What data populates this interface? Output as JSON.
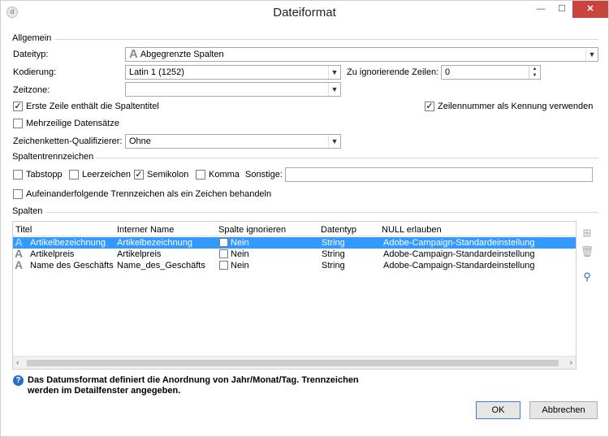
{
  "window": {
    "title": "Dateiformat",
    "min_glyph": "—",
    "max_glyph": "☐",
    "close_glyph": "✕",
    "app_glyph": "d"
  },
  "general": {
    "section_label": "Allgemein",
    "file_type_label": "Dateityp:",
    "file_type_value": "Abgegrenzte Spalten",
    "encoding_label": "Kodierung:",
    "encoding_value": "Latin 1 (1252)",
    "skip_rows_label": "Zu ignorierende Zeilen:",
    "skip_rows_value": "0",
    "timezone_label": "Zeitzone:",
    "timezone_value": "",
    "first_row_titles_label": "Erste Zeile enthält die Spaltentitel",
    "first_row_titles_checked": true,
    "line_number_id_label": "Zeilennummer als Kennung verwenden",
    "line_number_id_checked": true,
    "multiline_label": "Mehrzeilige Datensätze",
    "multiline_checked": false,
    "qualifier_label": "Zeichenketten-Qualifizierer:",
    "qualifier_value": "Ohne"
  },
  "separators": {
    "section_label": "Spaltentrennzeichen",
    "tab_label": "Tabstopp",
    "tab_checked": false,
    "space_label": "Leerzeichen",
    "space_checked": false,
    "semicolon_label": "Semikolon",
    "semicolon_checked": true,
    "comma_label": "Komma",
    "comma_checked": false,
    "other_label": "Sonstige:",
    "other_value": "",
    "consecutive_label": "Aufeinanderfolgende Trennzeichen als ein Zeichen behandeln",
    "consecutive_checked": false
  },
  "columns": {
    "section_label": "Spalten",
    "headers": [
      "Titel",
      "Interner Name",
      "Spalte ignorieren",
      "Datentyp",
      "NULL erlauben"
    ],
    "rows": [
      {
        "title": "Artikelbezeichnung",
        "internal_name": "Artikelbezeichnung",
        "ignore": "Nein",
        "type": "String",
        "null_policy": "Adobe-Campaign-Standardeinstellung"
      },
      {
        "title": "Artikelpreis",
        "internal_name": "Artikelpreis",
        "ignore": "Nein",
        "type": "String",
        "null_policy": "Adobe-Campaign-Standardeinstellung"
      },
      {
        "title": "Name des Geschäfts",
        "internal_name": "Name_des_Geschäfts",
        "ignore": "Nein",
        "type": "String",
        "null_policy": "Adobe-Campaign-Standardeinstellung"
      }
    ],
    "selected_row": 0
  },
  "info_text": "Das Datumsformat definiert die Anordnung von Jahr/Monat/Tag. Trennzeichen werden im Detailfenster angegeben.",
  "buttons": {
    "ok": "OK",
    "cancel": "Abbrechen"
  }
}
